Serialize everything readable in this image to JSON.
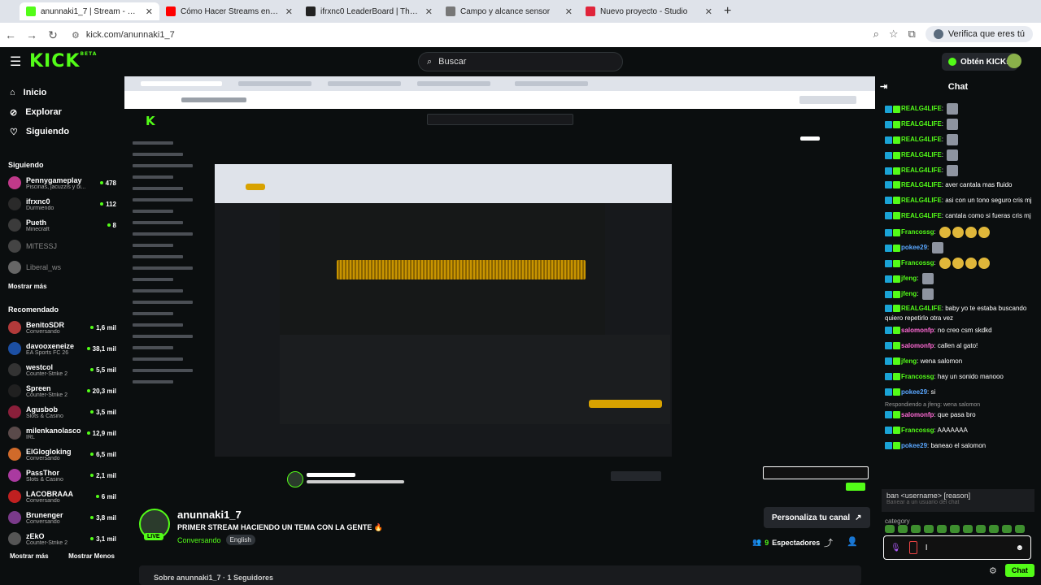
{
  "browser": {
    "tabs": [
      {
        "title": "anunnaki1_7 | Stream - Watch Li",
        "color": "#53fc18",
        "active": true
      },
      {
        "title": "Cómo Hacer Streams en Kick (C",
        "color": "#ff0000",
        "active": false
      },
      {
        "title": "ifrxnc0 LeaderBoard | The best",
        "color": "#222222",
        "active": false
      },
      {
        "title": "Campo y alcance sensor",
        "color": "#777777",
        "active": false
      },
      {
        "title": "Nuevo proyecto - Studio",
        "color": "#e0243a",
        "active": false
      }
    ],
    "url": "kick.com/anunnaki1_7",
    "verify_label": "Verifica que eres tú"
  },
  "header": {
    "logo": "KICK",
    "logo_sup": "BETA",
    "search_placeholder": "Buscar",
    "get_kicks": "Obtén KICKs"
  },
  "sidebar": {
    "nav": [
      {
        "label": "Inicio",
        "icon": "home-icon"
      },
      {
        "label": "Explorar",
        "icon": "compass-icon"
      },
      {
        "label": "Siguiendo",
        "icon": "heart-icon"
      }
    ],
    "following_title": "Siguiendo",
    "following": [
      {
        "name": "Pennygameplay",
        "sub": "Piscinas, jacuzzis y bi...",
        "viewers": "478",
        "color": "#c0398a",
        "online": true
      },
      {
        "name": "ifrxnc0",
        "sub": "Durmiendo",
        "viewers": "112",
        "color": "#2a2a2a",
        "online": true
      },
      {
        "name": "Pueth",
        "sub": "Minecraft",
        "viewers": "8",
        "color": "#3b3b3b",
        "online": true
      },
      {
        "name": "MITESSJ",
        "sub": "",
        "viewers": "",
        "color": "#444444",
        "online": false
      },
      {
        "name": "Liberal_ws",
        "sub": "",
        "viewers": "",
        "color": "#666666",
        "online": false
      }
    ],
    "show_more": "Mostrar más",
    "recommended_title": "Recomendado",
    "recommended": [
      {
        "name": "BenitoSDR",
        "sub": "Conversando",
        "viewers": "1,6 mil",
        "color": "#b23a3a"
      },
      {
        "name": "davooxeneize",
        "sub": "EA Sports FC 26",
        "viewers": "38,1 mil",
        "color": "#1c4fa3"
      },
      {
        "name": "westcol",
        "sub": "Counter-Strike 2",
        "viewers": "5,5 mil",
        "color": "#333333"
      },
      {
        "name": "Spreen",
        "sub": "Counter-Strike 2",
        "viewers": "20,3 mil",
        "color": "#202020"
      },
      {
        "name": "Agusbob",
        "sub": "Slots & Casino",
        "viewers": "3,5 mil",
        "color": "#8a1f3a"
      },
      {
        "name": "milenkanolasco",
        "sub": "IRL",
        "viewers": "12,9 mil",
        "color": "#5a4a4a"
      },
      {
        "name": "ElGlogloking",
        "sub": "Conversando",
        "viewers": "6,5 mil",
        "color": "#d06a2a"
      },
      {
        "name": "PassThor",
        "sub": "Slots & Casino",
        "viewers": "2,1 mil",
        "color": "#aa3aa0"
      },
      {
        "name": "LACOBRAAA",
        "sub": "Conversando",
        "viewers": "6 mil",
        "color": "#c02020"
      },
      {
        "name": "Brunenger",
        "sub": "Conversando",
        "viewers": "3,8 mil",
        "color": "#7a3a8a"
      },
      {
        "name": "zEkO",
        "sub": "Counter-Strike 2",
        "viewers": "3,1 mil",
        "color": "#555555"
      }
    ],
    "show_more_2": "Mostrar más",
    "show_less": "Mostrar Menos"
  },
  "stream": {
    "name": "anunnaki1_7",
    "title": "PRIMER STREAM HACIENDO UN TEMA CON LA GENTE 🔥",
    "category": "Conversando",
    "tag": "English",
    "live": "LIVE",
    "customize": "Personaliza tu canal",
    "viewers": "9",
    "viewers_label": "Espectadores",
    "about": "Sobre anunnaki1_7 · 1 Seguidores"
  },
  "chat": {
    "title": "Chat",
    "messages": [
      {
        "user": "REALG4LIFE",
        "text": "",
        "color": "green",
        "emote": "grey"
      },
      {
        "user": "REALG4LIFE",
        "text": "",
        "color": "green",
        "emote": "grey"
      },
      {
        "user": "REALG4LIFE",
        "text": "",
        "color": "green",
        "emote": "grey"
      },
      {
        "user": "REALG4LIFE",
        "text": "",
        "color": "green",
        "emote": "grey"
      },
      {
        "user": "REALG4LIFE",
        "text": "",
        "color": "green",
        "emote": "grey"
      },
      {
        "user": "REALG4LIFE",
        "text": "aver cantala mas fluido",
        "color": "green",
        "emote": ""
      },
      {
        "user": "REALG4LIFE",
        "text": "asi con un tono seguro cris mj",
        "color": "green",
        "emote": ""
      },
      {
        "user": "REALG4LIFE",
        "text": "cantala como si fueras cris mj",
        "color": "green",
        "emote": ""
      },
      {
        "user": "Francossg",
        "text": "",
        "color": "green",
        "emote": "gold"
      },
      {
        "user": "pokee29",
        "text": "",
        "color": "blue",
        "emote": "grey"
      },
      {
        "user": "Francossg",
        "text": "",
        "color": "green",
        "emote": "gold"
      },
      {
        "user": "jfeng",
        "text": "",
        "color": "green",
        "emote": "grey"
      },
      {
        "user": "jfeng",
        "text": "",
        "color": "green",
        "emote": "grey"
      },
      {
        "user": "REALG4LIFE",
        "text": "baby yo te estaba buscando quiero repetirlo otra vez",
        "color": "green",
        "emote": ""
      },
      {
        "user": "salomonfp",
        "text": "no creo csm skdkd",
        "color": "pink",
        "emote": ""
      },
      {
        "user": "salomonfp",
        "text": "callen al gato!",
        "color": "pink",
        "emote": ""
      },
      {
        "user": "jfeng",
        "text": "wena salomon",
        "color": "green",
        "emote": ""
      },
      {
        "user": "Francossg",
        "text": "hay un sonido manooo",
        "color": "green",
        "emote": ""
      },
      {
        "user": "pokee29",
        "text": "si",
        "color": "blue",
        "emote": ""
      },
      {
        "user": "salomonfp",
        "text": "que pasa bro",
        "color": "pink",
        "emote": ""
      },
      {
        "user": "Francossg",
        "text": "AAAAAAA",
        "color": "green",
        "emote": ""
      },
      {
        "user": "pokee29",
        "text": "baneao el salomon",
        "color": "blue",
        "emote": ""
      }
    ],
    "reply_note": "Respondiendo a jfeng: wena salomon",
    "ban_hint": "ban <username> [reason]",
    "ban_sub": "Banear a un usuario del chat",
    "category_label": "category",
    "chat_button": "Chat"
  }
}
